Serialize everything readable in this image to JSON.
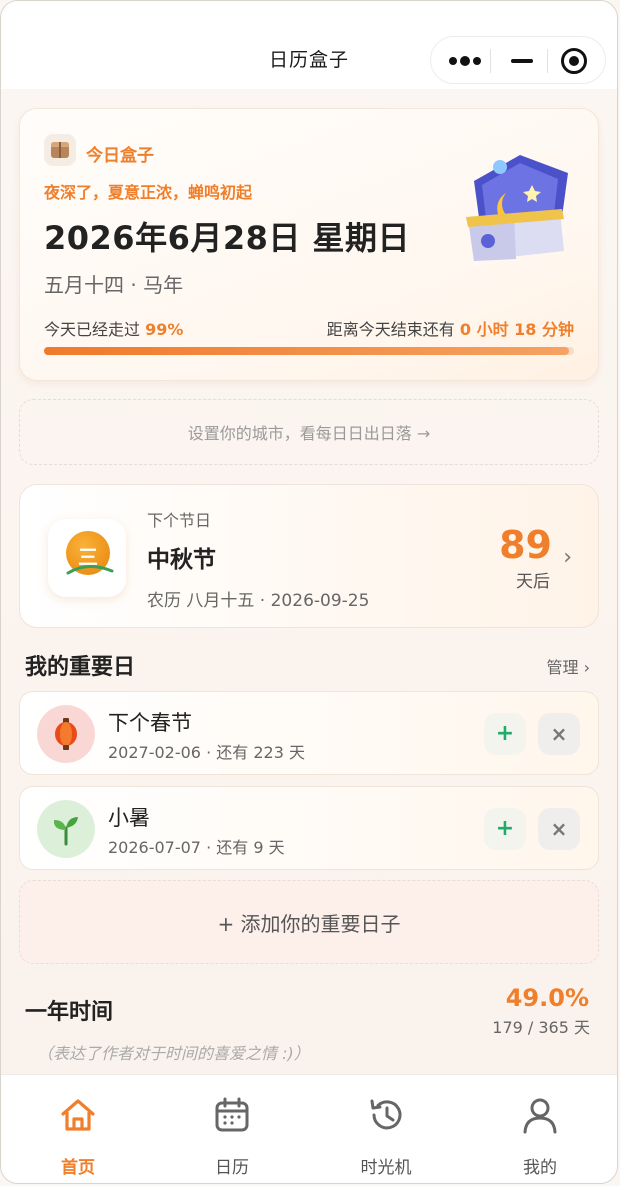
{
  "nav": {
    "title": "日历盒子"
  },
  "today": {
    "tag": "今日盒子",
    "poem": "夜深了，夏意正浓，蝉鸣初起",
    "date": "2026年6月28日 星期日",
    "lunar": "五月十四 · 马年",
    "passed_label": "今天已经走过",
    "passed_pct": "99%",
    "progress_fraction": 0.99,
    "remain_label": "距离今天结束还有",
    "remain_value": "0 小时 18 分钟"
  },
  "sunrise_hint": "设置你的城市，看每日日出日落 →",
  "festival": {
    "label": "下个节日",
    "name": "中秋节",
    "icon_text": "三",
    "date": "农历 八月十五 · 2026-09-25",
    "days": "89",
    "unit": "天后",
    "chevron": "›"
  },
  "important": {
    "title": "我的重要日",
    "manage": "管理 ›",
    "items": [
      {
        "name": "下个春节",
        "sub": "2027-02-06 · 还有 223 天",
        "icon": "lantern-icon",
        "avatar_bg": "#f9d7d4"
      },
      {
        "name": "小暑",
        "sub": "2026-07-07 · 还有 9 天",
        "icon": "sprout-icon",
        "avatar_bg": "#dcefd9"
      }
    ],
    "add_symbol": "+",
    "delete_symbol": "×",
    "add_label": "+ 添加你的重要日子"
  },
  "year": {
    "title": "一年时间",
    "pct": "49.0%",
    "count": "179 / 365 天",
    "note": "（表达了作者对于时间的喜爱之情 :)）"
  },
  "tabs": [
    {
      "label": "首页",
      "icon": "home-icon",
      "active": true
    },
    {
      "label": "日历",
      "icon": "calendar-icon",
      "active": false
    },
    {
      "label": "时光机",
      "icon": "history-icon",
      "active": false
    },
    {
      "label": "我的",
      "icon": "user-icon",
      "active": false
    }
  ],
  "colors": {
    "accent": "#f07f2c",
    "green": "#1fab6a"
  }
}
